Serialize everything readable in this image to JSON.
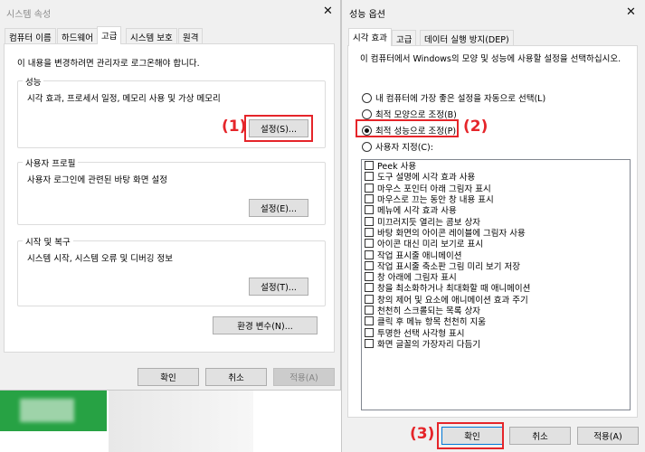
{
  "left_dialog": {
    "title": "시스템 속성",
    "tabs": [
      "컴퓨터 이름",
      "하드웨어",
      "고급",
      "시스템 보호",
      "원격"
    ],
    "active_tab": 2,
    "notice": "이 내용을 변경하려면 관리자로 로그온해야 합니다.",
    "performance": {
      "title": "성능",
      "desc": "시각 효과, 프로세서 일정, 메모리 사용 및 가상 메모리",
      "button": "설정(S)..."
    },
    "user_profile": {
      "title": "사용자 프로필",
      "desc": "사용자 로그인에 관련된 바탕 화면 설정",
      "button": "설정(E)..."
    },
    "startup": {
      "title": "시작 및 복구",
      "desc": "시스템 시작, 시스템 오류 및 디버깅 정보",
      "button": "설정(T)..."
    },
    "env_button": "환경 변수(N)...",
    "ok": "확인",
    "cancel": "취소",
    "apply": "적용(A)"
  },
  "right_dialog": {
    "title": "성능 옵션",
    "tabs": [
      "시각 효과",
      "고급",
      "데이터 실행 방지(DEP)"
    ],
    "active_tab": 0,
    "description": "이 컴퓨터에서 Windows의 모양 및 성능에 사용할 설정을 선택하십시오.",
    "radios": [
      {
        "label": "내 컴퓨터에 가장 좋은 설정을 자동으로 선택(L)",
        "checked": false
      },
      {
        "label": "최적 모양으로 조정(B)",
        "checked": false
      },
      {
        "label": "최적 성능으로 조정(P)",
        "checked": true
      },
      {
        "label": "사용자 지정(C):",
        "checked": false
      }
    ],
    "effects": [
      "Peek 사용",
      "도구 설명에 시각 효과 사용",
      "마우스 포인터 아래 그림자 표시",
      "마우스로 끄는 동안 창 내용 표시",
      "메뉴에 시각 효과 사용",
      "미끄러지듯 열리는 콤보 상자",
      "바탕 화면의 아이콘 레이블에 그림자 사용",
      "아이콘 대신 미리 보기로 표시",
      "작업 표시줄 애니메이션",
      "작업 표시줄 축소판 그림 미리 보기 저장",
      "창 아래에 그림자 표시",
      "창을 최소화하거나 최대화할 때 애니메이션",
      "창의 제어 및 요소에 애니메이션 효과 주기",
      "천천히 스크롤되는 목록 상자",
      "클릭 후 메뉴 항목 천천히 지움",
      "투명한 선택 사각형 표시",
      "화면 글꼴의 가장자리 다듬기"
    ],
    "ok": "확인",
    "cancel": "취소",
    "apply": "적용(A)"
  },
  "annotations": [
    "(1)",
    "(2)",
    "(3)"
  ],
  "colors": {
    "annotation_red": "#e5252a",
    "dialog_bg": "#f0f0f0",
    "button_bg": "#e1e1e1",
    "green_bg": "#27a244"
  }
}
